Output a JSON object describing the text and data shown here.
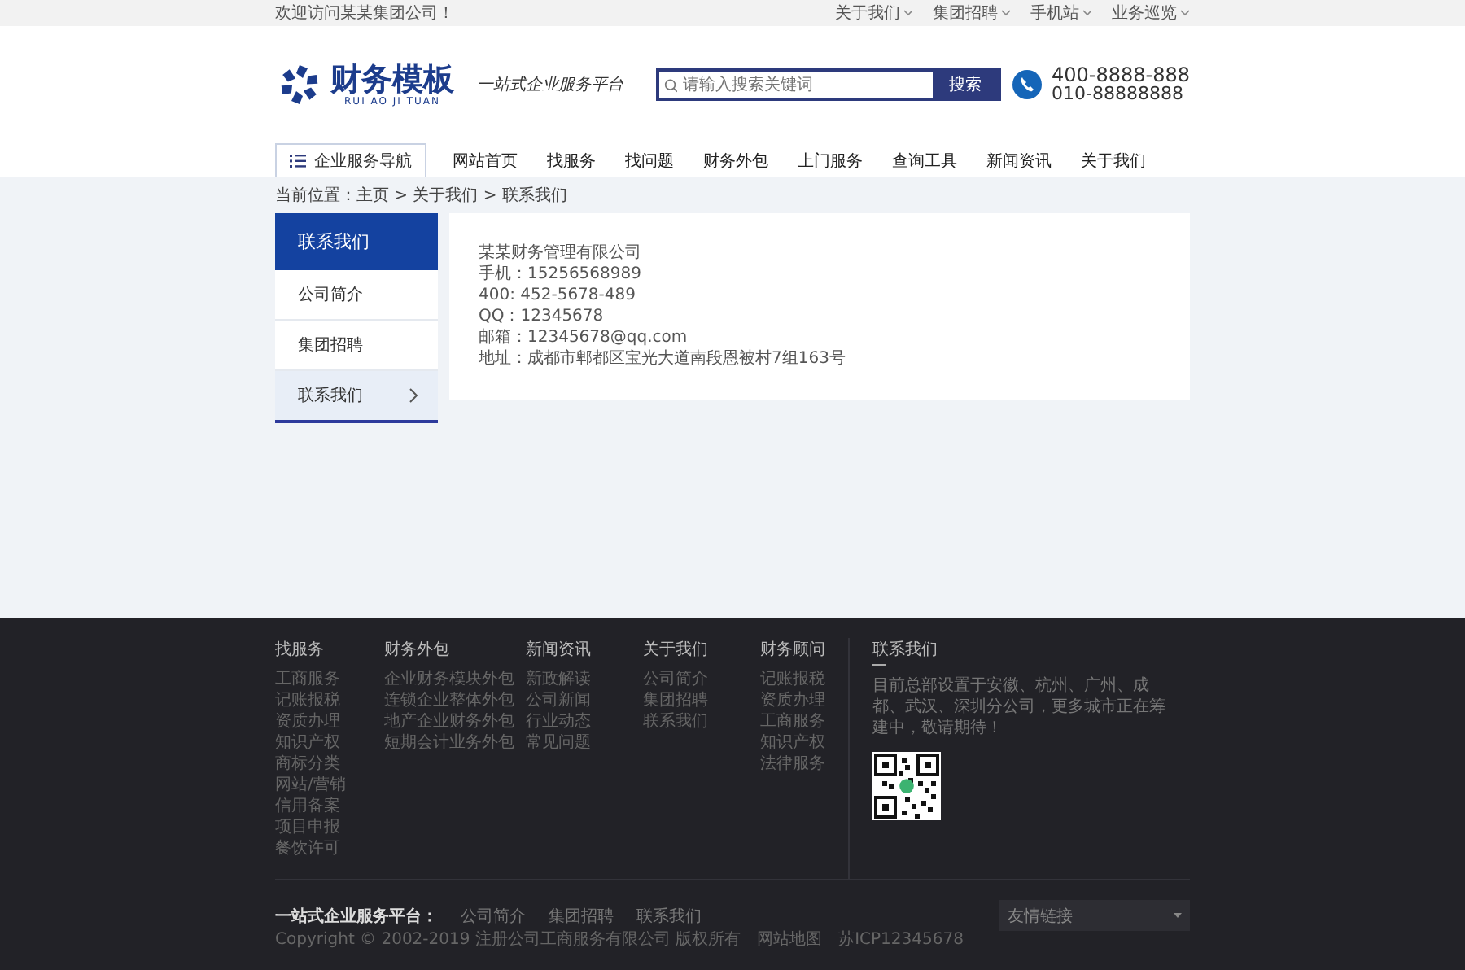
{
  "top_bar": {
    "welcome": "欢迎访问某某集团公司！",
    "links": [
      {
        "label": "关于我们"
      },
      {
        "label": "集团招聘"
      },
      {
        "label": "手机站"
      },
      {
        "label": "业务巡览"
      }
    ]
  },
  "header": {
    "logo_title": "财务模板",
    "logo_subtitle": "RUI AO JI TUAN",
    "slogan": "一站式企业服务平台",
    "search": {
      "placeholder": "请输入搜索关键词",
      "button": "搜索"
    },
    "phones": [
      "400-8888-888",
      "010-88888888"
    ]
  },
  "nav": {
    "category_button": "企业服务导航",
    "items": [
      "网站首页",
      "找服务",
      "找问题",
      "财务外包",
      "上门服务",
      "查询工具",
      "新闻资讯",
      "关于我们"
    ]
  },
  "breadcrumb": "当前位置：主页 > 关于我们 > 联系我们",
  "sidebar": {
    "title": "联系我们",
    "items": [
      {
        "label": "公司简介",
        "selected": false
      },
      {
        "label": "集团招聘",
        "selected": false
      },
      {
        "label": "联系我们",
        "selected": true
      }
    ]
  },
  "contact_lines": [
    "某某财务管理有限公司",
    "手机：15256568989",
    "400: 452-5678-489",
    "QQ：12345678",
    "邮箱：12345678@qq.com",
    "地址：成都市郫都区宝光大道南段恩被村7组163号"
  ],
  "footer": {
    "columns": [
      {
        "title": "找服务",
        "items": [
          "工商服务",
          "记账报税",
          "资质办理",
          "知识产权",
          "商标分类",
          "网站/营销",
          "信用备案",
          "项目申报",
          "餐饮许可"
        ]
      },
      {
        "title": "财务外包",
        "items": [
          "企业财务模块外包",
          "连锁企业整体外包",
          "地产企业财务外包",
          "短期会计业务外包"
        ]
      },
      {
        "title": "新闻资讯",
        "items": [
          "新政解读",
          "公司新闻",
          "行业动态",
          "常见问题"
        ]
      },
      {
        "title": "关于我们",
        "items": [
          "公司简介",
          "集团招聘",
          "联系我们"
        ]
      },
      {
        "title": "财务顾问",
        "items": [
          "记账报税",
          "资质办理",
          "工商服务",
          "知识产权",
          "法律服务"
        ]
      }
    ],
    "contact": {
      "title": "联系我们",
      "text": "目前总部设置于安徽、杭州、广州、成都、武汉、深圳分公司，更多城市正在筹建中，敬请期待！"
    },
    "platform_label": "一站式企业服务平台：",
    "bottom_links": [
      "公司简介",
      "集团招聘",
      "联系我们"
    ],
    "copyright": "Copyright © 2002-2019 注册公司工商服务有限公司 版权所有",
    "extra_links": [
      "网站地图",
      "苏ICP12345678"
    ],
    "friend_links": {
      "label": "友情链接"
    }
  }
}
